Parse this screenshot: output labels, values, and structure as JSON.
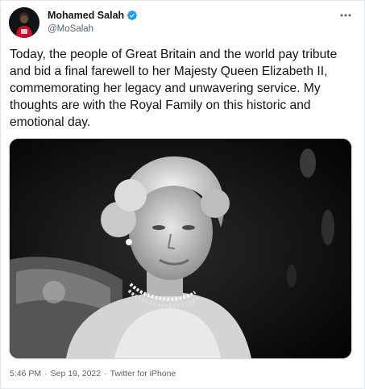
{
  "tweet": {
    "author": {
      "display_name": "Mohamed Salah",
      "handle": "@MoSalah",
      "verified_icon": "verified-badge-icon"
    },
    "more_icon": "more-options-icon",
    "text": "Today, the people of Great Britain and the world pay tribute and bid a final farewell to her Majesty Queen Elizabeth II, commemorating her legacy and unwavering service. My thoughts are with the Royal Family on this historic and emotional day.",
    "media": {
      "kind": "black-and-white portrait photo"
    },
    "time": "5:46 PM",
    "date": "Sep 19, 2022",
    "source": "Twitter for iPhone",
    "separator": "·"
  },
  "colors": {
    "text": "#0f1419",
    "secondary": "#536471",
    "verified": "#1d9bf0",
    "border": "#e1e8ed"
  }
}
